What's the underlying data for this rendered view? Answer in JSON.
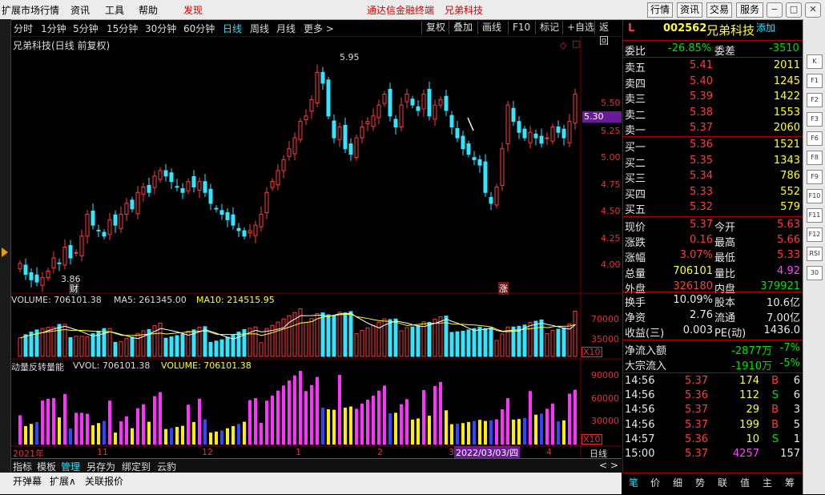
{
  "menu": {
    "items": [
      "扩展市场行情",
      "资讯",
      "工具",
      "帮助"
    ],
    "discover": "发现",
    "center_title": "通达信金融终端",
    "center_stock": "兄弟科技",
    "right_buttons": [
      "行情",
      "资讯",
      "交易",
      "服务"
    ]
  },
  "periods": [
    "分时",
    "1分钟",
    "5分钟",
    "15分钟",
    "30分钟",
    "60分钟",
    "日线",
    "周线",
    "月线",
    "更多 >"
  ],
  "active_period": "日线",
  "chart_tools": [
    "复权",
    "叠加",
    "画线",
    "F10",
    "标记",
    "+自选",
    "返回"
  ],
  "chart": {
    "title": "兄弟科技(日线 前复权)",
    "current_price_tag": "5.30",
    "high_label": "5.95",
    "low_label": "3.86",
    "marker_cai": "财",
    "marker_zhang": "涨",
    "price_ticks": [
      "5.50",
      "5.25",
      "5.00",
      "4.75",
      "4.50",
      "4.25",
      "4.00"
    ],
    "vol_legend": {
      "volume": "VOLUME: 706101.38",
      "ma5": "MA5: 261345.00",
      "ma10": "MA10: 214515.95"
    },
    "vol_ticks": [
      "70000",
      "35000"
    ],
    "vol_unit": "X10",
    "ind_legend": {
      "name": "动量反转量能",
      "vvol": "VVOL: 706101.38",
      "volume": "VOLUME: 706101.38"
    },
    "ind_ticks": [
      "90000",
      "60000",
      "30000"
    ],
    "ind_unit": "X10",
    "date_axis": [
      "2021年",
      "11",
      "12",
      "1",
      "2",
      "3",
      "4"
    ],
    "date_highlight": "2022/03/03/四",
    "period_label": "日线",
    "arrows": [
      "<",
      ">"
    ]
  },
  "chart_data": {
    "type": "candlestick",
    "price_range": [
      3.8,
      6.0
    ],
    "candles_approx_close": [
      4.05,
      3.95,
      3.9,
      3.88,
      3.92,
      3.98,
      4.1,
      4.05,
      4.2,
      4.1,
      4.15,
      4.3,
      4.5,
      4.4,
      4.35,
      4.3,
      4.45,
      4.4,
      4.5,
      4.6,
      4.55,
      4.7,
      4.75,
      4.7,
      4.85,
      4.9,
      4.85,
      4.8,
      4.75,
      4.7,
      4.8,
      4.75,
      4.8,
      4.7,
      4.6,
      4.55,
      4.5,
      4.45,
      4.4,
      4.35,
      4.3,
      4.35,
      4.4,
      4.5,
      4.7,
      4.8,
      4.9,
      5.0,
      5.1,
      5.2,
      5.35,
      5.4,
      5.55,
      5.8,
      5.7,
      5.4,
      5.2,
      5.3,
      5.1,
      5.05,
      5.2,
      5.3,
      5.35,
      5.4,
      5.5,
      5.6,
      5.4,
      5.3,
      5.5,
      5.6,
      5.5,
      5.45,
      5.6,
      5.4,
      5.5,
      5.55,
      5.45,
      5.3,
      5.2,
      5.1,
      5.05,
      5.0,
      4.95,
      4.7,
      4.6,
      4.75,
      5.1,
      5.5,
      5.35,
      5.25,
      5.2,
      5.25,
      5.2,
      5.15,
      5.2,
      5.3,
      5.25,
      5.2,
      5.35,
      5.6
    ]
  },
  "panel": {
    "flag": "L",
    "code": "002562",
    "name": "兄弟科技",
    "add_fav": "添加",
    "weibi_label": "委比",
    "weibi": "-26.85%",
    "weicha_label": "委差",
    "weicha": "-3510",
    "asks": [
      {
        "label": "卖五",
        "price": "5.41",
        "vol": "2011"
      },
      {
        "label": "卖四",
        "price": "5.40",
        "vol": "1245"
      },
      {
        "label": "卖三",
        "price": "5.39",
        "vol": "1422"
      },
      {
        "label": "卖二",
        "price": "5.38",
        "vol": "1553"
      },
      {
        "label": "卖一",
        "price": "5.37",
        "vol": "2060"
      }
    ],
    "bids": [
      {
        "label": "买一",
        "price": "5.36",
        "vol": "1521"
      },
      {
        "label": "买二",
        "price": "5.35",
        "vol": "1343"
      },
      {
        "label": "买三",
        "price": "5.34",
        "vol": "786"
      },
      {
        "label": "买四",
        "price": "5.33",
        "vol": "552"
      },
      {
        "label": "买五",
        "price": "5.32",
        "vol": "579"
      }
    ],
    "quote": [
      {
        "l1": "现价",
        "v1": "5.37",
        "c1": "c-red",
        "l2": "今开",
        "v2": "5.63",
        "c2": "c-red"
      },
      {
        "l1": "涨跌",
        "v1": "0.16",
        "c1": "c-red",
        "l2": "最高",
        "v2": "5.66",
        "c2": "c-red"
      },
      {
        "l1": "涨幅",
        "v1": "3.07%",
        "c1": "c-red",
        "l2": "最低",
        "v2": "5.33",
        "c2": "c-red"
      },
      {
        "l1": "总量",
        "v1": "706101",
        "c1": "c-yellow",
        "l2": "量比",
        "v2": "4.92",
        "c2": "c-mag"
      },
      {
        "l1": "外盘",
        "v1": "326180",
        "c1": "c-red",
        "l2": "内盘",
        "v2": "379921",
        "c2": "c-green"
      }
    ],
    "fund": [
      {
        "l1": "换手",
        "v1": "10.09%",
        "l2": "股本",
        "v2": "10.6亿"
      },
      {
        "l1": "净资",
        "v1": "2.76",
        "l2": "流通",
        "v2": "7.00亿"
      },
      {
        "l1": "收益(三)",
        "v1": "0.003",
        "l2": "PE(动)",
        "v2": "1436.0"
      }
    ],
    "flows": [
      {
        "label": "净流入额",
        "value": "-2877万",
        "pct": "-7%"
      },
      {
        "label": "大宗流入",
        "value": "-1910万",
        "pct": "-5%"
      }
    ],
    "ticks": [
      {
        "time": "14:56",
        "price": "5.37",
        "pc": "c-red",
        "vol": "174",
        "bs": "B",
        "bc": "c-red",
        "n": "6"
      },
      {
        "time": "14:56",
        "price": "5.36",
        "pc": "c-red",
        "vol": "112",
        "bs": "S",
        "bc": "c-green",
        "n": "6"
      },
      {
        "time": "14:56",
        "price": "5.37",
        "pc": "c-red",
        "vol": "29",
        "bs": "B",
        "bc": "c-red",
        "n": "3"
      },
      {
        "time": "14:56",
        "price": "5.37",
        "pc": "c-red",
        "vol": "199",
        "bs": "B",
        "bc": "c-red",
        "n": "5"
      },
      {
        "time": "14:57",
        "price": "5.36",
        "pc": "c-red",
        "vol": "10",
        "bs": "S",
        "bc": "c-green",
        "n": "1"
      },
      {
        "time": "15:00",
        "price": "5.37",
        "pc": "c-red",
        "vol": "4257",
        "bs": "",
        "bc": "c-mag",
        "n": "157"
      }
    ],
    "bottom_tabs": [
      "笔",
      "价",
      "细",
      "势",
      "联",
      "值",
      "主",
      "筹"
    ]
  },
  "bottom_tabs": [
    "指标",
    "模板",
    "管理",
    "另存为",
    "绑定到",
    "云豹"
  ],
  "active_bottom_tab": "管理",
  "status": [
    "开弹幕",
    "扩展∧",
    "关联报价"
  ],
  "sidebar_icons": [
    "K",
    "F1",
    "F2",
    "F3",
    "F6",
    "F8",
    "F9",
    "F10",
    "F11",
    "F12",
    "RSI",
    "30"
  ],
  "colors": {
    "up": "#ff3b3b",
    "down": "#33e6ff",
    "bg": "#000000",
    "ma10": "#ffff33",
    "ma5": "#ffffff",
    "ind_up": "#ff33ff",
    "ind_down_a": "#ffee00",
    "ind_down_b": "#3344ff"
  }
}
